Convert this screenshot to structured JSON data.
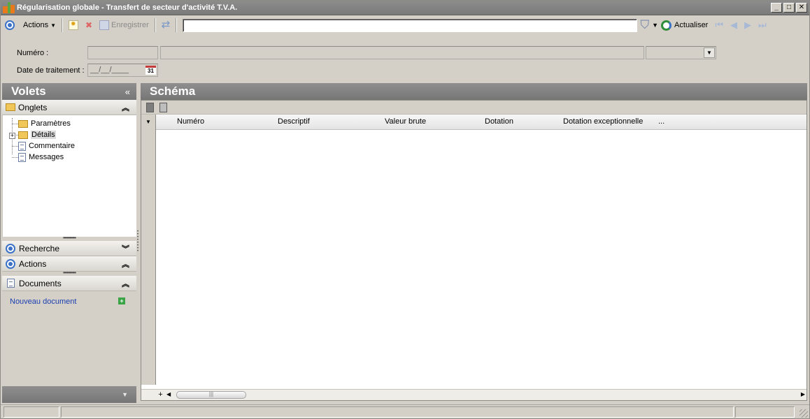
{
  "window": {
    "title": "Régularisation globale - Transfert de secteur d'activité T.V.A.",
    "minimize": "_",
    "maximize": "□",
    "close": "✕"
  },
  "toolbar": {
    "actions_label": "Actions",
    "save_label": "Enregistrer",
    "refresh_label": "Actualiser",
    "search_value": ""
  },
  "form": {
    "numero_label": "Numéro :",
    "date_label": "Date de traitement :",
    "date_placeholder": "__/__/____",
    "calendar_day": "31"
  },
  "left_panel": {
    "title": "Volets",
    "collapse_glyph": "«",
    "onglets": {
      "label": "Onglets",
      "items": [
        {
          "label": "Paramètres",
          "icon": "folder-icon"
        },
        {
          "label": "Détails",
          "icon": "folder-open-icon"
        },
        {
          "label": "Commentaire",
          "icon": "document-icon"
        },
        {
          "label": "Messages",
          "icon": "document-icon"
        }
      ]
    },
    "recherche_label": "Recherche",
    "actions_label": "Actions",
    "documents": {
      "label": "Documents",
      "new_document": "Nouveau document"
    }
  },
  "right_panel": {
    "title": "Schéma",
    "columns": [
      "Numéro",
      "Descriptif",
      "Valeur brute",
      "Dotation",
      "Dotation exceptionnelle",
      "..."
    ]
  },
  "colors": {
    "panel_header": "#808080",
    "link": "#1a3fb0",
    "accent_blue": "#3b72c7",
    "accent_green": "#2f8e3a"
  }
}
